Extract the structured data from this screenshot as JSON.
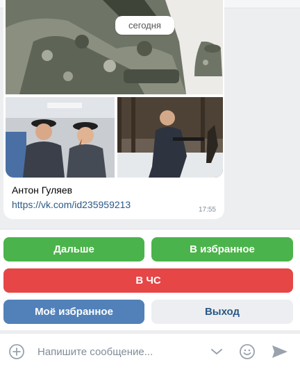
{
  "chat": {
    "date_label": "сегодня",
    "message": {
      "sender": "Антон Гуляев",
      "link": "https://vk.com/id235959213",
      "time": "17:55"
    }
  },
  "keyboard": {
    "rows": [
      [
        {
          "label": "Дальше",
          "color": "#4bb34b"
        },
        {
          "label": "В избранное",
          "color": "#4bb34b"
        }
      ],
      [
        {
          "label": "В ЧС",
          "color": "#e64646"
        }
      ],
      [
        {
          "label": "Моё избранное",
          "color": "#5181b8"
        },
        {
          "label": "Выход",
          "color": "#eceef1"
        }
      ]
    ]
  },
  "composer": {
    "placeholder": "Напишите сообщение...",
    "icons": [
      "plus-icon",
      "chevron-down-icon",
      "emoji-icon",
      "send-icon"
    ]
  }
}
